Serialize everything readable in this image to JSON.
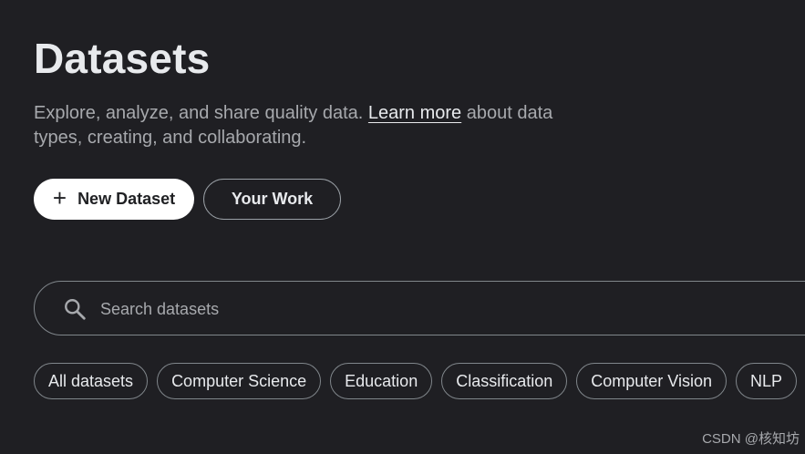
{
  "header": {
    "title": "Datasets",
    "subtitle_before": "Explore, analyze, and share quality data.",
    "learn_more": "Learn more",
    "subtitle_after": "about data types, creating, and collaborating."
  },
  "actions": {
    "new_dataset": "New Dataset",
    "your_work": "Your Work"
  },
  "search": {
    "placeholder": "Search datasets",
    "value": ""
  },
  "chips": [
    {
      "label": "All datasets"
    },
    {
      "label": "Computer Science"
    },
    {
      "label": "Education"
    },
    {
      "label": "Classification"
    },
    {
      "label": "Computer Vision"
    },
    {
      "label": "NLP"
    }
  ],
  "watermark": "CSDN @核知坊",
  "colors": {
    "background": "#1f1f23",
    "text_primary": "#e8eaed",
    "text_secondary": "#a7a9ad",
    "border": "#80868b",
    "primary_button": "#ffffff"
  },
  "icons": {
    "plus": "plus-icon",
    "search": "search-icon"
  }
}
